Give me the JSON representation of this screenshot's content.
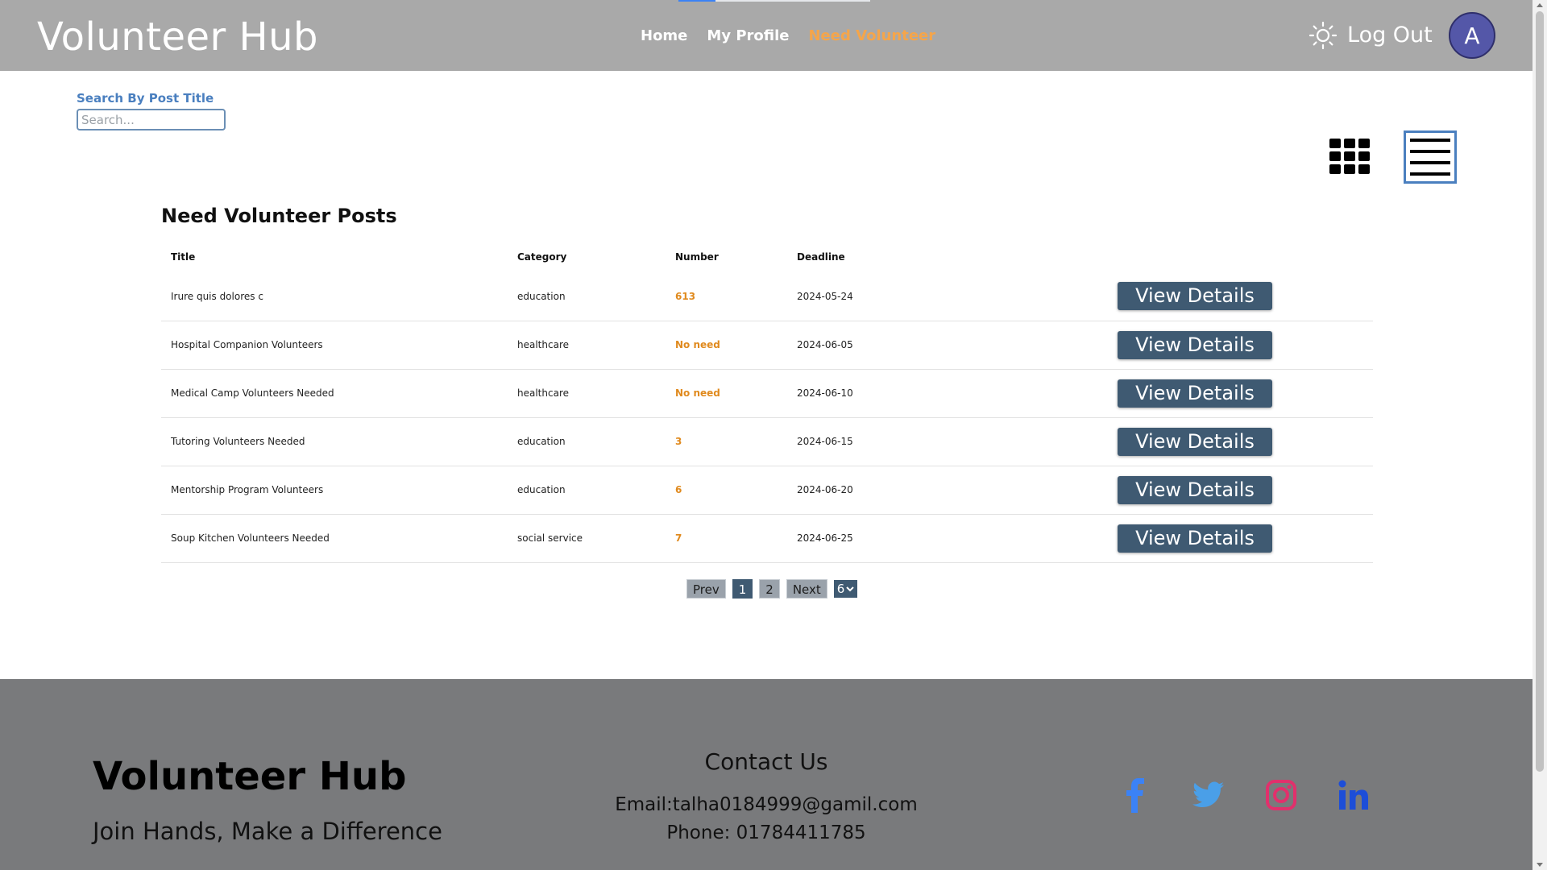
{
  "header": {
    "brand": "Volunteer Hub",
    "nav": [
      {
        "label": "Home",
        "active": false
      },
      {
        "label": "My Profile",
        "active": false
      },
      {
        "label": "Need Volunteer",
        "active": true
      }
    ],
    "logout_label": "Log Out",
    "avatar_initial": "A"
  },
  "search": {
    "label": "Search By Post Title",
    "placeholder": "Search...",
    "value": ""
  },
  "section": {
    "title": "Need Volunteer Posts"
  },
  "table": {
    "columns": [
      "Title",
      "Category",
      "Number",
      "Deadline"
    ],
    "rows": [
      {
        "title": "Irure quis dolores c",
        "category": "education",
        "number": "613",
        "deadline": "2024-05-24",
        "action": "View Details"
      },
      {
        "title": "Hospital Companion Volunteers",
        "category": "healthcare",
        "number": "No need",
        "deadline": "2024-06-05",
        "action": "View Details"
      },
      {
        "title": "Medical Camp Volunteers Needed",
        "category": "healthcare",
        "number": "No need",
        "deadline": "2024-06-10",
        "action": "View Details"
      },
      {
        "title": "Tutoring Volunteers Needed",
        "category": "education",
        "number": "3",
        "deadline": "2024-06-15",
        "action": "View Details"
      },
      {
        "title": "Mentorship Program Volunteers",
        "category": "education",
        "number": "6",
        "deadline": "2024-06-20",
        "action": "View Details"
      },
      {
        "title": "Soup Kitchen Volunteers Needed",
        "category": "social service",
        "number": "7",
        "deadline": "2024-06-25",
        "action": "View Details"
      }
    ]
  },
  "pagination": {
    "prev_label": "Prev",
    "pages": [
      "1",
      "2"
    ],
    "current_page": "1",
    "next_label": "Next",
    "per_page": "6"
  },
  "footer": {
    "brand": "Volunteer Hub",
    "tagline": "Join Hands, Make a Difference",
    "contact_title": "Contact Us",
    "email": "Email:talha0184999@gamil.com",
    "phone": "Phone: 01784411785"
  },
  "icons": {
    "theme": "sun-icon",
    "grid_view": "grid-icon",
    "list_view": "list-icon",
    "socials": [
      "facebook-icon",
      "twitter-icon",
      "instagram-icon",
      "linkedin-icon"
    ]
  },
  "colors": {
    "header_bg": "#a9a9a9",
    "nav_active": "#f5a54a",
    "button_bg": "#3f5a72",
    "number_accent": "#e08a1e",
    "footer_bg": "#797a7c",
    "facebook": "#3b82f6",
    "twitter": "#4a9fe8",
    "instagram": "#e1306c",
    "linkedin": "#1d4ed8"
  }
}
